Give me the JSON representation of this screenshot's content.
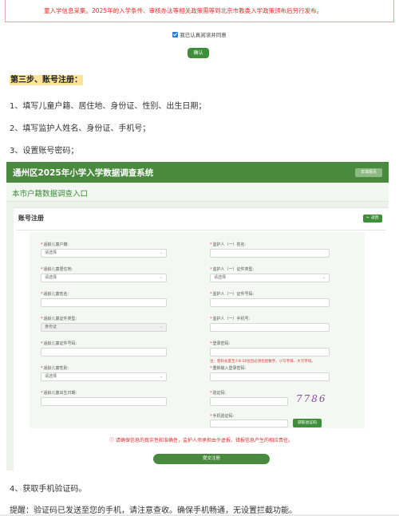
{
  "notice": {
    "text": "童入学信息采集。2025年的入学条件、审核办法等相关政策需等到北京市教委入学政策颁布后另行发布。"
  },
  "agree": {
    "label": "我已认真阅读并同意"
  },
  "confirm_button": "确认",
  "step3": {
    "heading": "第三步、账号注册：",
    "items": [
      "1、填写儿童户籍、居住地、身份证、性别、出生日期；",
      "2、填写监护人姓名、身份证、手机号；",
      "3、设置账号密码；"
    ]
  },
  "system": {
    "title": "通州区2025年小学入学数据调查系统",
    "top_button": "去填报页",
    "entry": "本市户籍数据调查入口",
    "form_title": "账号注册",
    "return_button": "← 返回",
    "left_fields": [
      {
        "label": "适龄儿童户籍:",
        "value": "请选择",
        "type": "select"
      },
      {
        "label": "适龄儿童居住地:",
        "value": "请选择",
        "type": "select"
      },
      {
        "label": "适龄儿童姓名:",
        "value": "",
        "type": "input"
      },
      {
        "label": "适龄儿童证件类型:",
        "value": "身份证",
        "type": "disabled"
      },
      {
        "label": "适龄儿童证件号码:",
        "value": "",
        "type": "input"
      },
      {
        "label": "适龄儿童性别:",
        "value": "请选择",
        "type": "select"
      },
      {
        "label": "适龄儿童出生日期:",
        "value": "",
        "type": "input"
      }
    ],
    "right_fields": [
      {
        "label": "监护人（一）姓名:",
        "value": "",
        "type": "input"
      },
      {
        "label": "监护人（一）证件类型:",
        "value": "请选择",
        "type": "select"
      },
      {
        "label": "监护人（一）证件号码:",
        "value": "",
        "type": "input"
      },
      {
        "label": "监护人（一）手机号:",
        "value": "",
        "type": "input"
      },
      {
        "label": "登录密码:",
        "value": "",
        "type": "input"
      },
      {
        "label": "重新输入登录密码:",
        "value": "",
        "type": "input"
      },
      {
        "label": "验证码:",
        "value": "",
        "type": "input"
      },
      {
        "label": "手机验证码:",
        "value": "",
        "type": "input"
      }
    ],
    "password_hint": "注：密码长度至少8-16位且必须包括数字、小写字母、大写字母。",
    "captcha_text": "7786",
    "sms_button": "获取验证码",
    "warning": "ⓘ 请确保信息的真实性和准确性，监护人须承担由于虚报、错报信息产生的相应责任。",
    "submit_button": "提交注册"
  },
  "step4": "4、获取手机验证码。",
  "reminder": "提醒：验证码已发送至您的手机，请注意查收。确保手机畅通，无设置拦截功能。",
  "colors": {
    "brand_green": "#4a8a3f",
    "warning_red": "#d9302b",
    "highlight": "#fbe39a"
  }
}
